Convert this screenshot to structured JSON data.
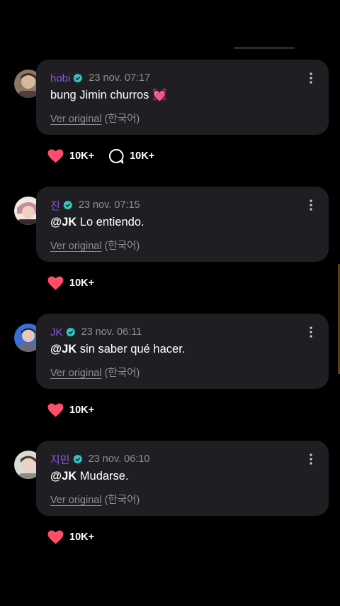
{
  "theme": {
    "name_color": "#8c52e9",
    "verified_color": "#35c6c0",
    "heart_color": "#ff4d6a",
    "bubble_color": "#1f1f23"
  },
  "comments": [
    {
      "author": "hobi",
      "time": "23 nov. 07:17",
      "mention": "",
      "text": "bung Jimin churros 💓",
      "translate_link": "Ver original",
      "translate_lang": "(한국어)",
      "likes": "10K+",
      "replies": "10K+",
      "avatar_icon": "avatar-hobi"
    },
    {
      "author": "진",
      "time": "23 nov. 07:15",
      "mention": "@JK",
      "text": " Lo entiendo.",
      "translate_link": "Ver original",
      "translate_lang": "(한국어)",
      "likes": "10K+",
      "avatar_icon": "avatar-jin"
    },
    {
      "author": "JK",
      "time": "23 nov. 06:11",
      "mention": "@JK",
      "text": " sin saber qué hacer.",
      "translate_link": "Ver original",
      "translate_lang": "(한국어)",
      "likes": "10K+",
      "avatar_icon": "avatar-jk"
    },
    {
      "author": "지민",
      "time": "23 nov. 06:10",
      "mention": "@JK",
      "text": " Mudarse.",
      "translate_link": "Ver original",
      "translate_lang": "(한국어)",
      "likes": "10K+",
      "avatar_icon": "avatar-jimin"
    }
  ]
}
